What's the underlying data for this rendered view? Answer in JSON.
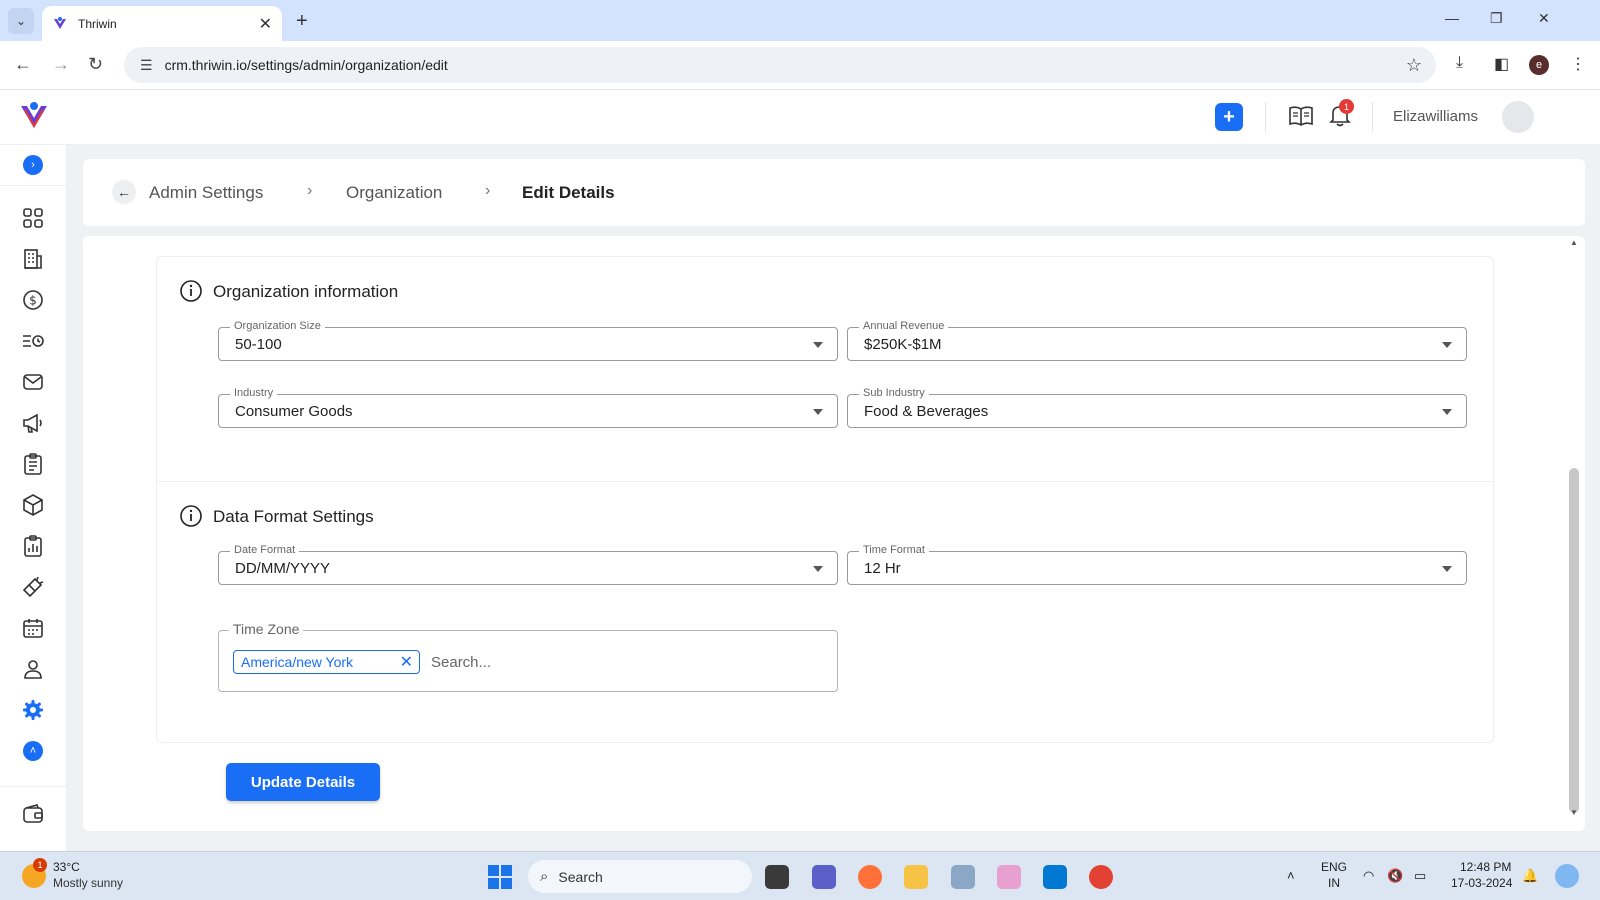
{
  "browser": {
    "tab_title": "Thriwin",
    "tab_close": "✕",
    "new_tab": "+",
    "url": "crm.thriwin.io/settings/admin/organization/edit",
    "minimize": "—",
    "restore": "❐",
    "close": "✕",
    "profile_initial": "e"
  },
  "header": {
    "username": "Elizawilliams",
    "notification_count": "1",
    "plus_label": "+"
  },
  "breadcrumb": {
    "items": [
      "Admin Settings",
      "Organization",
      "Edit Details"
    ]
  },
  "sections": {
    "org_info": {
      "title": "Organization information",
      "fields": [
        {
          "label": "Organization Size",
          "value": "50-100"
        },
        {
          "label": "Annual Revenue",
          "value": "$250K-$1M"
        },
        {
          "label": "Industry",
          "value": "Consumer Goods"
        },
        {
          "label": "Sub Industry",
          "value": "Food & Beverages"
        }
      ]
    },
    "data_format": {
      "title": "Data Format Settings",
      "fields": [
        {
          "label": "Date Format",
          "value": "DD/MM/YYYY"
        },
        {
          "label": "Time Format",
          "value": "12 Hr"
        }
      ],
      "time_zone": {
        "label": "Time Zone",
        "chip": "America/new York",
        "placeholder": "Search..."
      }
    }
  },
  "actions": {
    "update_label": "Update Details"
  },
  "taskbar": {
    "weather_temp": "33°C",
    "weather_desc": "Mostly sunny",
    "weather_badge": "1",
    "search_label": "Search",
    "lang_top": "ENG",
    "lang_bottom": "IN",
    "time": "12:48 PM",
    "date": "17-03-2024"
  },
  "colors": {
    "accent": "#1a6ef5",
    "badge": "#e53935"
  }
}
